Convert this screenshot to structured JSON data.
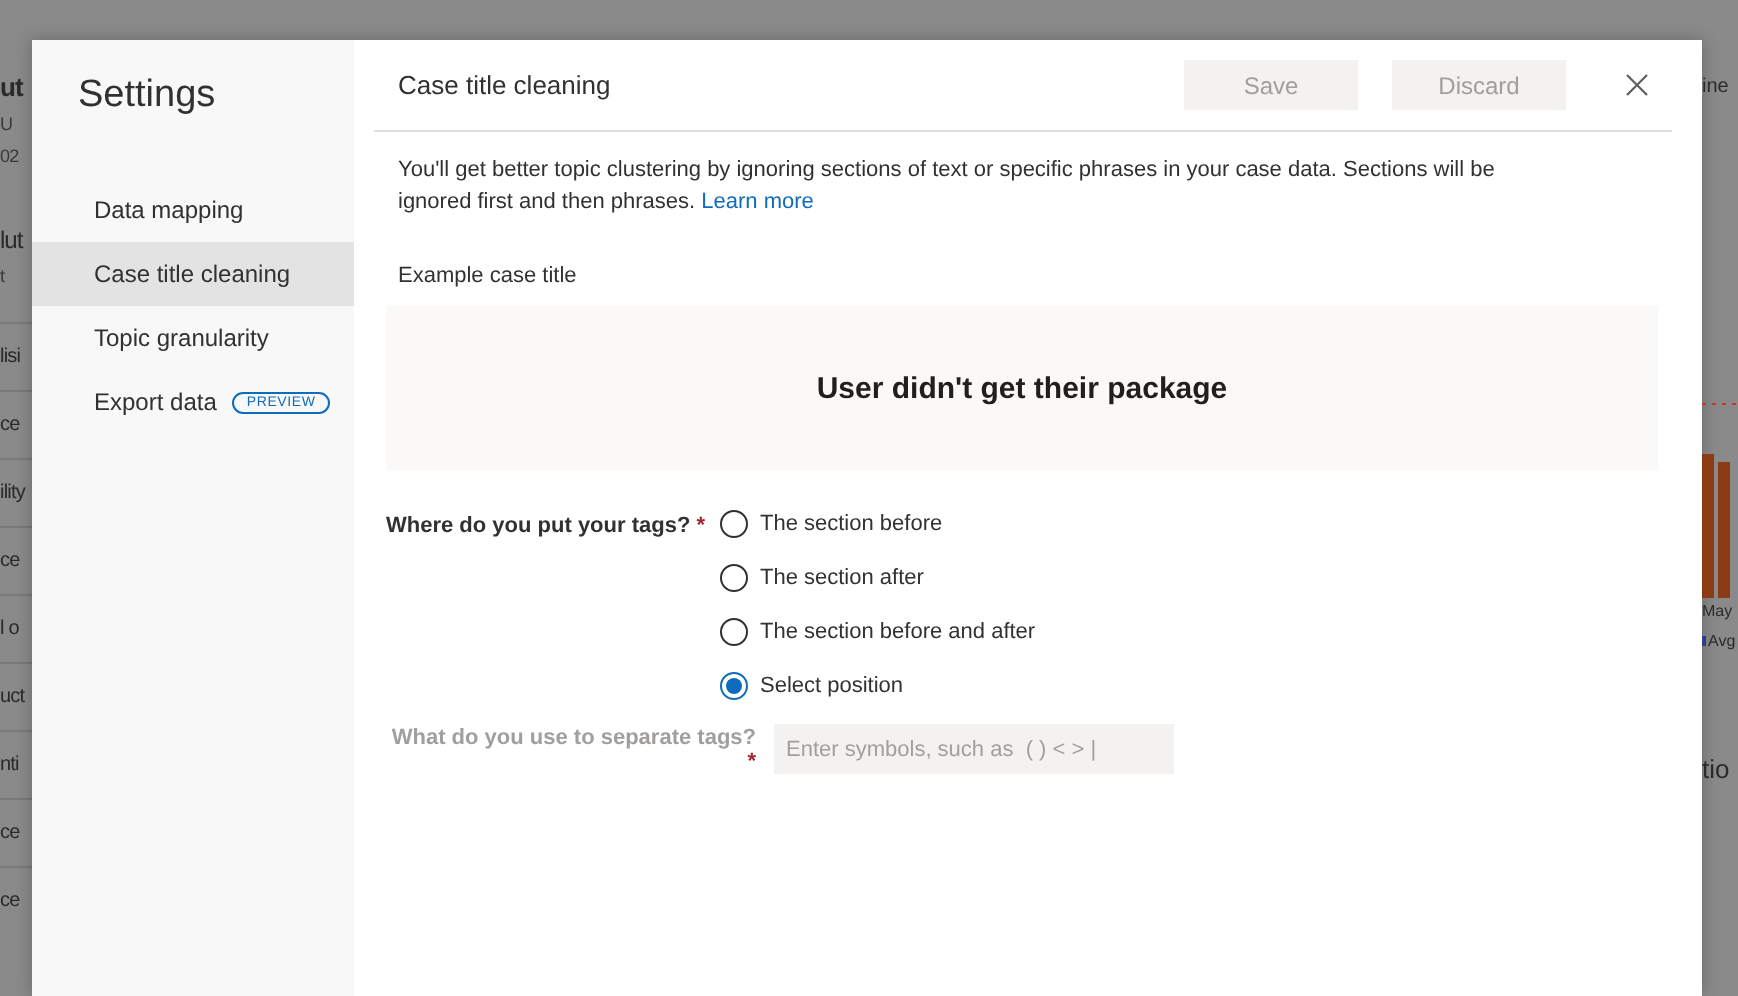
{
  "backdrop": {
    "left_fragments": [
      {
        "text": "ut",
        "kind": "title"
      },
      {
        "text": "U",
        "kind": "meta"
      },
      {
        "text": "02",
        "kind": "meta"
      },
      {
        "text": "lut",
        "kind": "heading"
      },
      {
        "text": "t",
        "kind": "meta"
      },
      {
        "text": "lisi",
        "kind": "row"
      },
      {
        "text": "ce",
        "kind": "row"
      },
      {
        "text": "ility",
        "kind": "row"
      },
      {
        "text": "ce",
        "kind": "row"
      },
      {
        "text": "l o",
        "kind": "row"
      },
      {
        "text": "uct",
        "kind": "row"
      },
      {
        "text": "nti",
        "kind": "row"
      },
      {
        "text": "ce",
        "kind": "row"
      },
      {
        "text": "ce",
        "kind": "row"
      }
    ],
    "right_fragments": {
      "top": "ine",
      "axis_label": "May",
      "legend": "Avg",
      "heading": "tio"
    }
  },
  "settings": {
    "title": "Settings",
    "nav": [
      {
        "label": "Data mapping",
        "selected": false
      },
      {
        "label": "Case title cleaning",
        "selected": true
      },
      {
        "label": "Topic granularity",
        "selected": false
      },
      {
        "label": "Export data",
        "selected": false,
        "badge": "PREVIEW"
      }
    ]
  },
  "panel": {
    "title": "Case title cleaning",
    "buttons": [
      {
        "label": "Save",
        "disabled": true
      },
      {
        "label": "Discard",
        "disabled": true
      }
    ],
    "description": "You'll get better topic clustering by ignoring sections of text or specific phrases in your case data. Sections will be ignored first and then phrases.",
    "link": "Learn more",
    "example_label": "Example case title",
    "example_title": "User didn't get their package",
    "question": {
      "label": "Where do you put your tags?",
      "required_mark": "*",
      "options": [
        {
          "label": "The section before",
          "selected": false
        },
        {
          "label": "The section after",
          "selected": false
        },
        {
          "label": "The section before and after",
          "selected": false
        },
        {
          "label": "Select position",
          "selected": true
        }
      ]
    },
    "separator_field": {
      "label": "What do you use to separate tags?",
      "required_mark": "*",
      "disabled": true,
      "placeholder": "Enter symbols, such as  ( ) < > |"
    }
  }
}
